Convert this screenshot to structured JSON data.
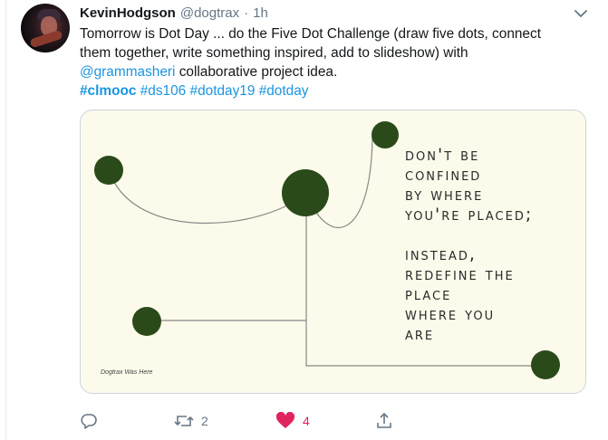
{
  "tweet": {
    "display_name": "KevinHodgson",
    "handle": "@dogtrax",
    "separator": "·",
    "timestamp": "1h",
    "text": {
      "line1": "Tomorrow is Dot Day ... do the Five Dot Challenge (draw five dots, connect",
      "line2": "them together, write something inspired, add to slideshow) with",
      "mention": "@grammasheri",
      "line3_rest": " collaborative project idea.",
      "hashtags": [
        "#clmooc",
        "#ds106",
        "#dotday19",
        "#dotday"
      ]
    }
  },
  "media": {
    "quote_lines_1": [
      "Don't be",
      "confined",
      "by where",
      "you're placed;"
    ],
    "quote_lines_2": [
      "Instead,",
      "redefine the",
      "place",
      "where you",
      "are"
    ],
    "credit": "Dogtrax Was Here",
    "background_color": "#fcfaea",
    "dot_color": "#2a4a1a",
    "line_color": "#888888"
  },
  "actions": {
    "reply_icon": "reply-icon",
    "retweet_icon": "retweet-icon",
    "retweet_count": "2",
    "like_icon": "heart-icon",
    "like_count": "4",
    "share_icon": "share-icon",
    "like_color": "#e0245e",
    "muted_color": "#657786"
  },
  "colors": {
    "link": "#1b95e0",
    "text": "#14171a"
  }
}
